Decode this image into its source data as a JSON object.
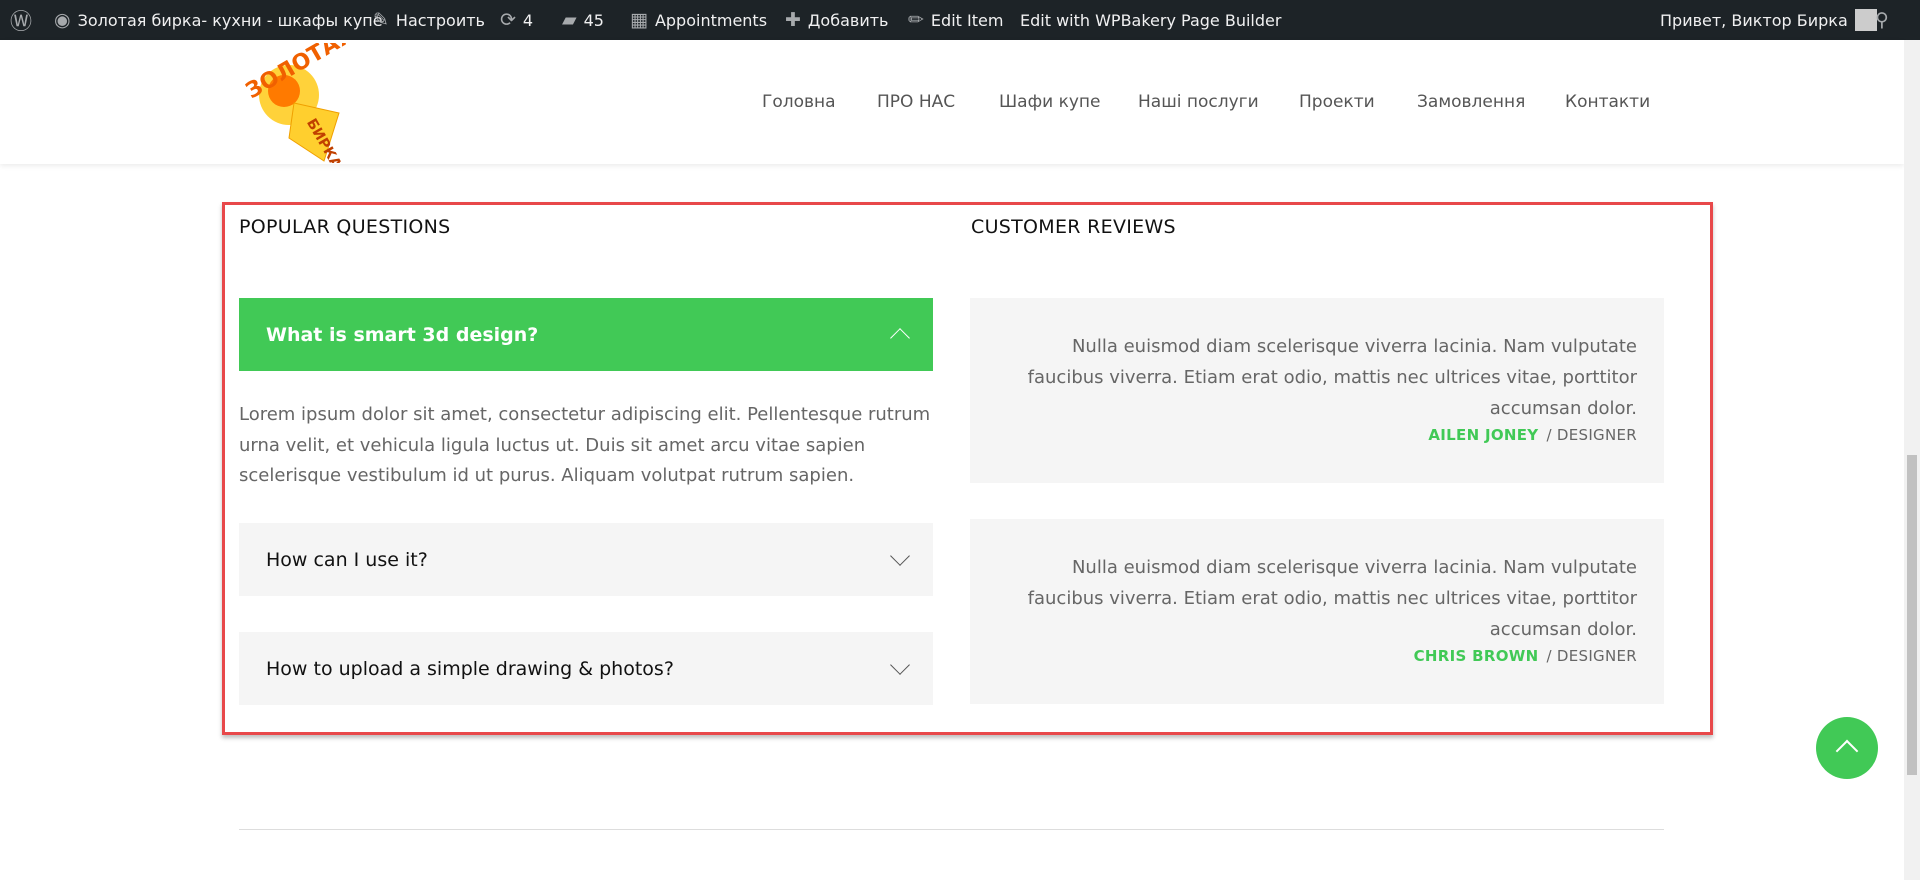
{
  "adminbar": {
    "site": "Золотая бирка- кухни - шкафы купе",
    "customize": "Настроить",
    "updates": "4",
    "comments": "45",
    "appointments": "Appointments",
    "add": "Добавить",
    "edit_item": "Edit Item",
    "wpbakery": "Edit with WPBakery Page Builder",
    "greeting": "Привет, Виктор Бирка"
  },
  "logo": {
    "text": "ЗОЛОТАЯ БИРКА"
  },
  "nav": [
    "Головна",
    "ПРО НАС",
    "Шафи купе",
    "Наші послуги",
    "Проекти",
    "Замовлення",
    "Контакти"
  ],
  "faq": {
    "title": "POPULAR QUESTIONS",
    "items": [
      {
        "q": "What is smart 3d design?",
        "open": true,
        "a": "Lorem ipsum dolor sit amet, consectetur adipiscing elit. Pellentesque rutrum urna velit, et vehicula ligula luctus ut. Duis sit amet arcu vitae sapien scelerisque vestibulum id ut purus. Aliquam volutpat rutrum sapien."
      },
      {
        "q": "How can I use it?",
        "open": false
      },
      {
        "q": "How to upload a simple drawing & photos?",
        "open": false
      }
    ]
  },
  "reviews": {
    "title": "CUSTOMER REVIEWS",
    "items": [
      {
        "text": "Nulla euismod diam scelerisque viverra lacinia. Nam vulputate faucibus viverra. Etiam erat odio, mattis nec ultrices vitae, porttitor accumsan dolor.",
        "name": "AILEN JONEY",
        "role": "/ DESIGNER"
      },
      {
        "text": "Nulla euismod diam scelerisque viverra lacinia. Nam vulputate faucibus viverra. Etiam erat odio, mattis nec ultrices vitae, porttitor accumsan dolor.",
        "name": "CHRIS BROWN",
        "role": "/ DESIGNER"
      }
    ]
  },
  "colors": {
    "accent": "#41c956",
    "adminbar": "#1d2327",
    "highlight": "#e8484a"
  }
}
